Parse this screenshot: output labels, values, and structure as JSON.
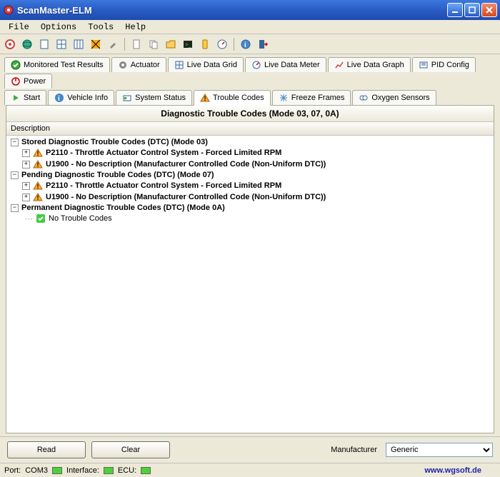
{
  "window": {
    "title": "ScanMaster-ELM"
  },
  "menu": {
    "file": "File",
    "options": "Options",
    "tools": "Tools",
    "help": "Help"
  },
  "tabs_row1": [
    {
      "icon": "check-icon",
      "label": "Monitored Test Results"
    },
    {
      "icon": "gear-icon",
      "label": "Actuator"
    },
    {
      "icon": "grid-icon",
      "label": "Live Data Grid"
    },
    {
      "icon": "meter-icon",
      "label": "Live Data Meter"
    },
    {
      "icon": "graph-icon",
      "label": "Live Data Graph"
    },
    {
      "icon": "pid-icon",
      "label": "PID Config"
    },
    {
      "icon": "power-icon",
      "label": "Power"
    }
  ],
  "tabs_row2": [
    {
      "icon": "start-icon",
      "label": "Start"
    },
    {
      "icon": "info-icon",
      "label": "Vehicle Info"
    },
    {
      "icon": "status-icon",
      "label": "System Status"
    },
    {
      "icon": "warning-icon",
      "label": "Trouble Codes",
      "active": true
    },
    {
      "icon": "freeze-icon",
      "label": "Freeze Frames"
    },
    {
      "icon": "o2-icon",
      "label": "Oxygen Sensors"
    }
  ],
  "panel": {
    "title": "Diagnostic Trouble Codes (Mode 03, 07, 0A)",
    "column": "Description"
  },
  "tree": [
    {
      "type": "group",
      "expand": "-",
      "label": "Stored Diagnostic Trouble Codes (DTC) (Mode 03)"
    },
    {
      "type": "item",
      "expand": "+",
      "label": "P2110 - Throttle Actuator Control System - Forced Limited RPM"
    },
    {
      "type": "item",
      "expand": "+",
      "label": "U1900 - No Description (Manufacturer Controlled Code (Non-Uniform DTC))"
    },
    {
      "type": "group",
      "expand": "-",
      "label": "Pending Diagnostic Trouble Codes (DTC) (Mode 07)"
    },
    {
      "type": "item",
      "expand": "+",
      "label": "P2110 - Throttle Actuator Control System - Forced Limited RPM"
    },
    {
      "type": "item",
      "expand": "+",
      "label": "U1900 - No Description (Manufacturer Controlled Code (Non-Uniform DTC))"
    },
    {
      "type": "group",
      "expand": "-",
      "label": "Permanent Diagnostic Trouble Codes (DTC) (Mode 0A)"
    },
    {
      "type": "nocodes",
      "label": "No Trouble Codes"
    }
  ],
  "actions": {
    "read": "Read",
    "clear": "Clear",
    "manufacturer_label": "Manufacturer",
    "manufacturer_value": "Generic"
  },
  "status": {
    "port_label": "Port:",
    "port_value": "COM3",
    "interface_label": "Interface:",
    "ecu_label": "ECU:",
    "link": "www.wgsoft.de"
  }
}
